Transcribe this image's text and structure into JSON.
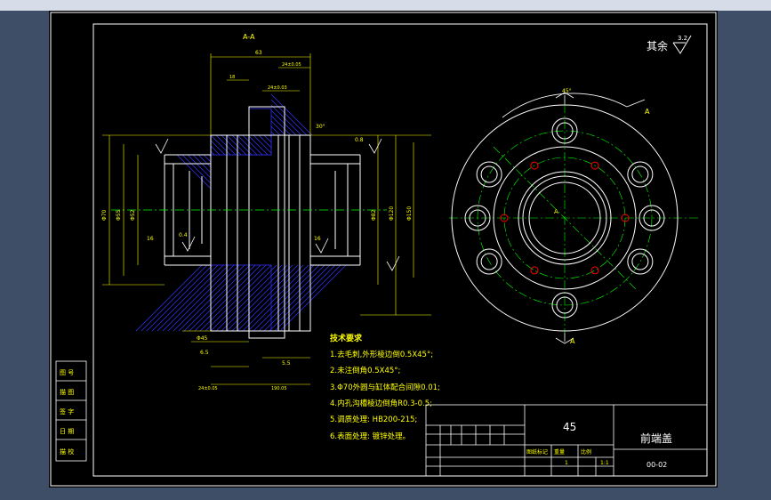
{
  "view_label": "A-A",
  "roughness": {
    "label": "其余",
    "value": "3.2"
  },
  "section_marks": {
    "top": "A",
    "bottom": "A",
    "center": "A"
  },
  "dimensions": {
    "top_len": "63",
    "top_a": "24±0.05",
    "top_b": "24±0.03",
    "top_c": "18",
    "left_d1": "Φ70",
    "left_d2": "Φ55",
    "left_d3": "Φ52",
    "right_d1": "Φ150",
    "right_d2": "Φ120",
    "right_d3": "Φ82",
    "angle": "30°",
    "bolt_angle": "45°",
    "left_04": "0.4",
    "right_08": "0.8",
    "r16a": "16",
    "r16b": "16",
    "bottom_a": "Φ45",
    "bottom_b": "6.5",
    "bottom_c": "5.5",
    "bottom_d": "24±0.05",
    "bottom_e": "190.05"
  },
  "tech_requirements": {
    "title": "技术要求",
    "items": [
      "1.去毛刺,外形棱边倒0.5X45°;",
      "2.未注倒角0.5X45°;",
      "3.Φ70外圆与缸体配合间隙0.01;",
      "4.内孔沟槽棱边倒角R0.3-0.5;",
      "5.调质处理: HB200-215;",
      "6.表面处理: 镀锌处理。"
    ]
  },
  "title_block": {
    "material": "45",
    "part_name": "前端盖",
    "drawing_no": "00-02",
    "label_a": "图纸标记",
    "label_b": "重量",
    "label_c": "比例",
    "num1": "1",
    "num2": "1:1"
  },
  "side_tags": [
    "图 号",
    "描 图",
    "签 字",
    "日 期",
    "描 校"
  ],
  "colors": {
    "background": "#000000",
    "border": "#ffffff",
    "lines": "#ffffff",
    "dims": "#ffff00",
    "centerline": "#00ff00",
    "hatch": "#3333ff",
    "accent": "#ff0000",
    "frame": "#3e4e66"
  }
}
